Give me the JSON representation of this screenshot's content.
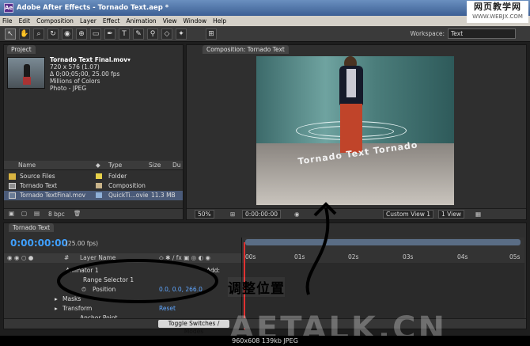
{
  "window": {
    "title": "Adobe After Effects - Tornado Text.aep *"
  },
  "watermark": {
    "line1": "网页教学网",
    "line2": "WWW.WEBJX.COM",
    "big": "AETALK.CN"
  },
  "menu": [
    "File",
    "Edit",
    "Composition",
    "Layer",
    "Effect",
    "Animation",
    "View",
    "Window",
    "Help"
  ],
  "workspace": {
    "label": "Workspace:",
    "value": "Text"
  },
  "project": {
    "tab": "Project",
    "preview": {
      "name": "Tornado Text Final.mov▾",
      "dims": "720 x 576 (1.07)",
      "duration": "Δ 0;00;05;00, 25.00 fps",
      "colors": "Millions of Colors",
      "codec": "Photo - JPEG"
    },
    "columns": {
      "name": "Name",
      "type": "Type",
      "size": "Size",
      "du": "Du"
    },
    "items": [
      {
        "name": "Source Files",
        "type": "Folder",
        "size": "",
        "color": "#e8d24a"
      },
      {
        "name": "Tornado Text",
        "type": "Composition",
        "size": "",
        "color": "#c9b48a"
      },
      {
        "name": "Tornado TextFinal.mov",
        "type": "QuickTi...ovie",
        "size": "11.3 MB",
        "color": "#8fb0d8"
      }
    ],
    "bpc": "8 bpc"
  },
  "composition": {
    "tab": "Composition: Tornado Text",
    "zoom": "50%",
    "timecode": "0:00:00:00",
    "view": "Custom View 1",
    "views": "1 View",
    "text_in_view": "Tornado Text Tornado"
  },
  "timeline": {
    "tab": "Tornado Text",
    "time": "0:00:00:00",
    "fps": "(25.00 fps)",
    "header": {
      "num": "#",
      "layer": "Layer Name"
    },
    "rows": [
      {
        "label": "Animator 1",
        "indent": 78
      },
      {
        "label": "Range Selector 1",
        "indent": 100
      },
      {
        "label": "Position",
        "indent": 112,
        "value": "0.0, 0.0, 266.0"
      },
      {
        "label": "Masks",
        "indent": 74
      },
      {
        "label": "Transform",
        "indent": 74,
        "value": "Reset"
      },
      {
        "label": "Anchor Point",
        "indent": 96
      }
    ],
    "add_label": "Add:",
    "ruler": [
      "00s",
      "01s",
      "02s",
      "03s",
      "04s",
      "05s"
    ],
    "toggle": "Toggle Switches / Modes"
  },
  "annotation": {
    "callout": "调整位置"
  },
  "status": "960x608  139kb  JPEG"
}
